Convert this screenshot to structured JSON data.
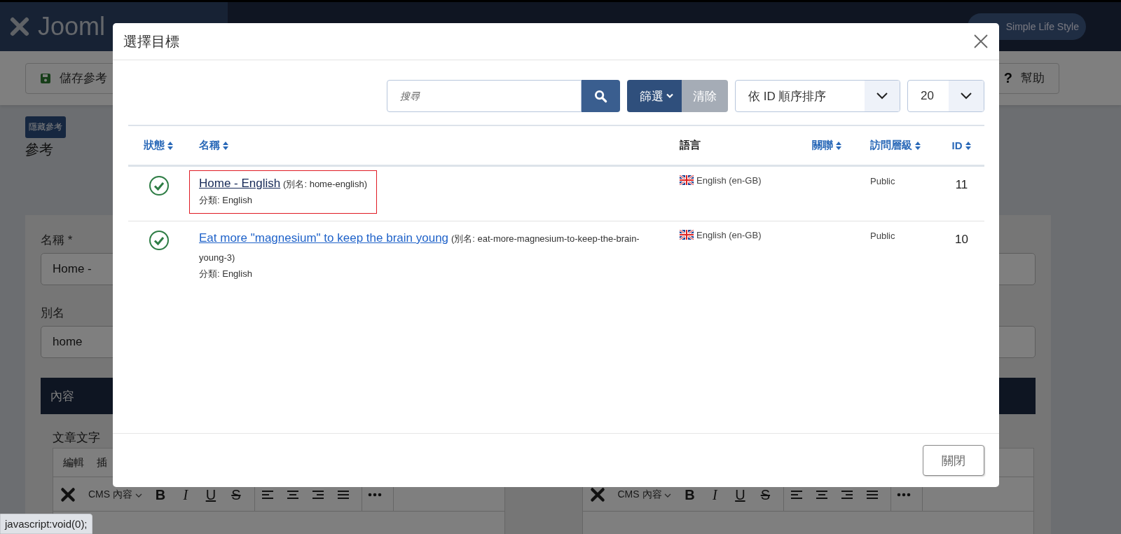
{
  "header": {
    "logo": "Jooml",
    "user": "Simple Life Style"
  },
  "toolbar": {
    "save": "儲存參考",
    "help_icon": "?",
    "help": "幫助"
  },
  "reference": {
    "toggle": "隱藏參考",
    "heading": "參考"
  },
  "form": {
    "fields": [
      {
        "label": "名稱 *",
        "value": "Home -"
      },
      {
        "label": "別名",
        "value": "home"
      }
    ],
    "tab": "內容",
    "editors": [
      {
        "label": "文章文字",
        "menu": [
          "編輯",
          "插"
        ],
        "cms": "CMS 內容",
        "format": [
          "B",
          "I",
          "U",
          "S"
        ]
      },
      {
        "cms": "CMS 內容",
        "format": [
          "B",
          "I",
          "U",
          "S"
        ]
      }
    ]
  },
  "status_bar": "javascript:void(0);",
  "modal": {
    "title": "選擇目標",
    "search": {
      "placeholder": "搜尋"
    },
    "filter_button": "篩選",
    "clear_button": "清除",
    "sort": "依 ID 順序排序",
    "limit": "20",
    "columns": [
      {
        "label": "狀態",
        "sortable": true
      },
      {
        "label": "名稱",
        "sortable": true
      },
      {
        "label": "語言",
        "sortable": false
      },
      {
        "label": "關聯",
        "sortable": true
      },
      {
        "label": "訪問層級",
        "sortable": true
      },
      {
        "label": "ID",
        "sortable": true
      }
    ],
    "rows": [
      {
        "published": true,
        "title": "Home - English",
        "visited": true,
        "highlighted": true,
        "alias": "(別名: home-english)",
        "category": "分類: English",
        "language": "English (en-GB)",
        "access": "Public",
        "id": "11"
      },
      {
        "published": true,
        "title": "Eat more \"magnesium\" to keep the brain young",
        "visited": false,
        "highlighted": false,
        "alias": "(別名: eat-more-magnesium-to-keep-the-brain-young-3)",
        "category": "分類: English",
        "language": "English (en-GB)",
        "access": "Public",
        "id": "10"
      }
    ],
    "close_button": "關閉"
  }
}
